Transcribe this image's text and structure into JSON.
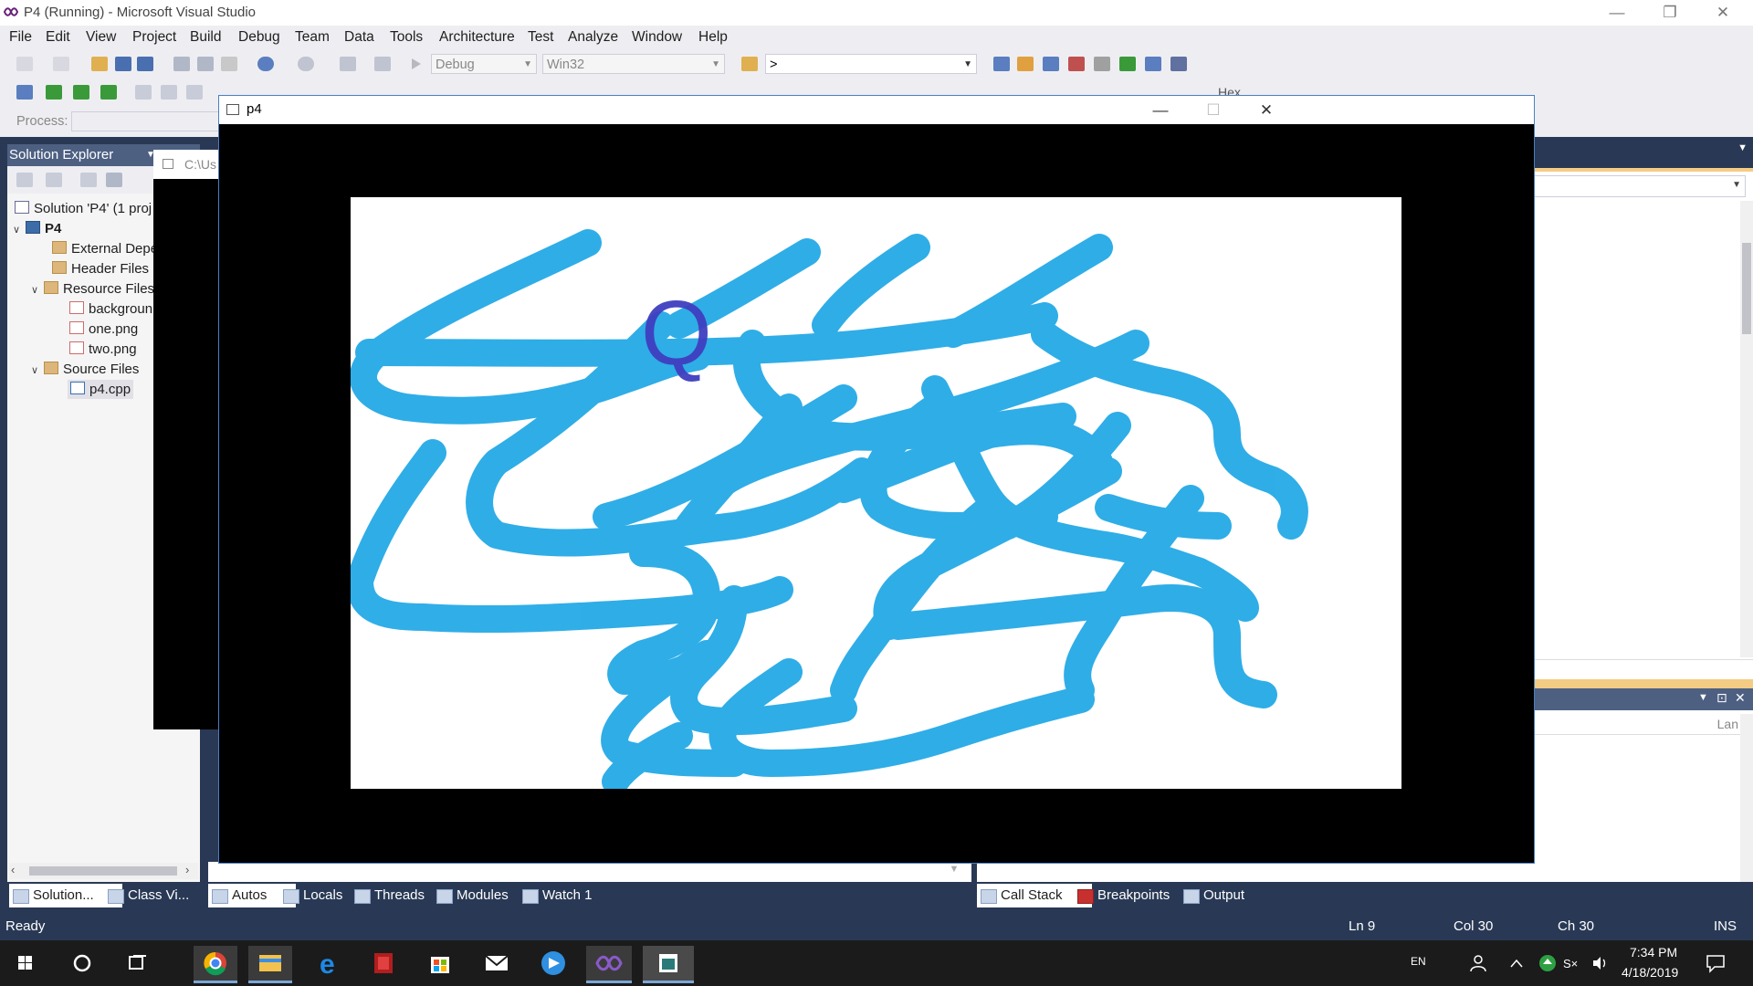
{
  "vs": {
    "title": "P4 (Running) - Microsoft Visual Studio",
    "menu": [
      "File",
      "Edit",
      "View",
      "Project",
      "Build",
      "Debug",
      "Team",
      "Data",
      "Tools",
      "Architecture",
      "Test",
      "Analyze",
      "Window",
      "Help"
    ],
    "toolbar": {
      "config": "Debug",
      "platform": "Win32",
      "find_value": ">",
      "process_label": "Process:",
      "hex_label": "Hex"
    }
  },
  "solution_explorer": {
    "title": "Solution Explorer",
    "items": [
      {
        "label": "Solution 'P4' (1 proj",
        "icon": "solution-icon"
      },
      {
        "label": "P4",
        "icon": "project-icon"
      },
      {
        "label": "External Depe",
        "icon": "folder-icon"
      },
      {
        "label": "Header Files",
        "icon": "folder-icon"
      },
      {
        "label": "Resource Files",
        "icon": "folder-icon"
      },
      {
        "label": "backgroun",
        "icon": "png-file-icon"
      },
      {
        "label": "one.png",
        "icon": "png-file-icon"
      },
      {
        "label": "two.png",
        "icon": "png-file-icon"
      },
      {
        "label": "Source Files",
        "icon": "folder-icon"
      },
      {
        "label": "p4.cpp",
        "icon": "cpp-file-icon"
      }
    ]
  },
  "console_window": {
    "title": "C:\\Us"
  },
  "bottom_tabs": {
    "left": [
      "Solution...",
      "Class Vi..."
    ],
    "debug": [
      "Autos",
      "Locals",
      "Threads",
      "Modules",
      "Watch 1"
    ],
    "right": [
      "Call Stack",
      "Breakpoints",
      "Output"
    ]
  },
  "right_panel": {
    "column_header": "Lan"
  },
  "status": {
    "ready": "Ready",
    "line": "Ln 9",
    "col": "Col 30",
    "ch": "Ch 30",
    "mode": "INS"
  },
  "app_window": {
    "title": "p4",
    "canvas_letter": "Q",
    "stroke_color": "#1ea7e6",
    "letter_color": "#3f3fc0"
  },
  "taskbar": {
    "lang": "EN",
    "time": "7:34 PM",
    "date": "4/18/2019",
    "apps": [
      "start-icon",
      "cortana-icon",
      "task-view-icon",
      "chrome-icon",
      "file-explorer-icon",
      "edge-icon",
      "media-app-icon",
      "store-icon",
      "mail-icon",
      "video-app-icon",
      "visual-studio-icon",
      "p4-app-icon"
    ]
  }
}
